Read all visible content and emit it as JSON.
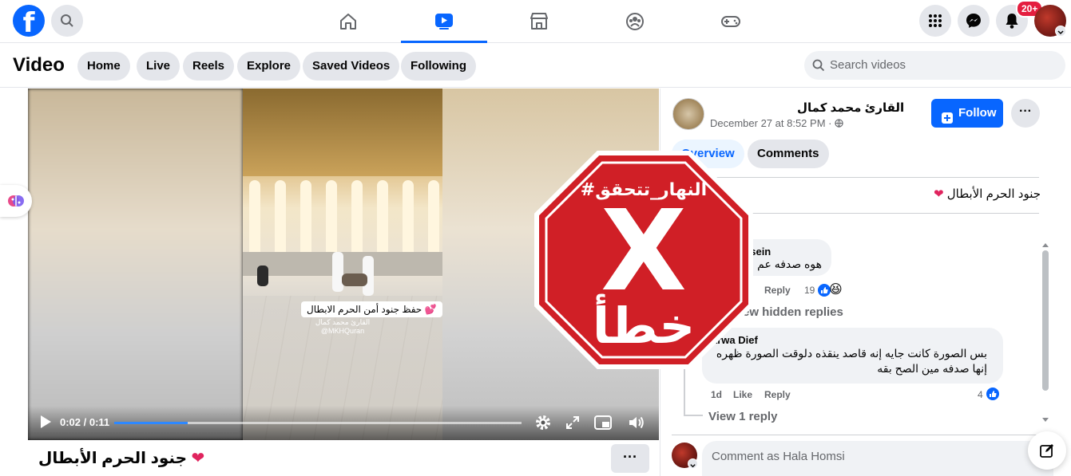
{
  "topbar": {
    "logo_letter": "f",
    "notifications_badge": "20+"
  },
  "video_nav": {
    "title": "Video",
    "tabs": [
      "Home",
      "Live",
      "Reels",
      "Explore",
      "Saved Videos",
      "Following"
    ],
    "search_placeholder": "Search videos"
  },
  "player": {
    "current_time": "0:02 / 0:11",
    "progress": 0.18,
    "overlay_caption": "حفظ جنود أمن الحرم الابطال 💕",
    "watermark_name": "القارئ محمد كمال",
    "watermark_handle": "@MKHQuran"
  },
  "stamp": {
    "hashtag": "#النهار_تتحقق",
    "mark": "X",
    "verdict": "خطأ",
    "color": "#d01f26"
  },
  "video_title": "جنود الحرم الأبطال",
  "post": {
    "page_name": "القارئ محمد كمال",
    "date": "December 27 at 8:52 PM · ",
    "follow_label": "Follow",
    "tabs": [
      "Overview",
      "Comments"
    ],
    "text": "جنود الحرم الأبطال"
  },
  "comments": [
    {
      "author": "ssein",
      "text": "هوه صدفه عم",
      "reply": "Reply",
      "reactions": "19"
    },
    {
      "view_hidden": "ew hidden replies"
    },
    {
      "author": "arwa Dief",
      "text": "بس الصورة كانت جايه إنه قاصد ينقذه دلوقت الصورة ظهره إنها صدفه مين الصح بقه",
      "time": "1d",
      "like": "Like",
      "reply": "Reply",
      "reactions": "4",
      "view_replies": "View 1 reply"
    }
  ],
  "composer": {
    "placeholder": "Comment as Hala Homsi"
  }
}
